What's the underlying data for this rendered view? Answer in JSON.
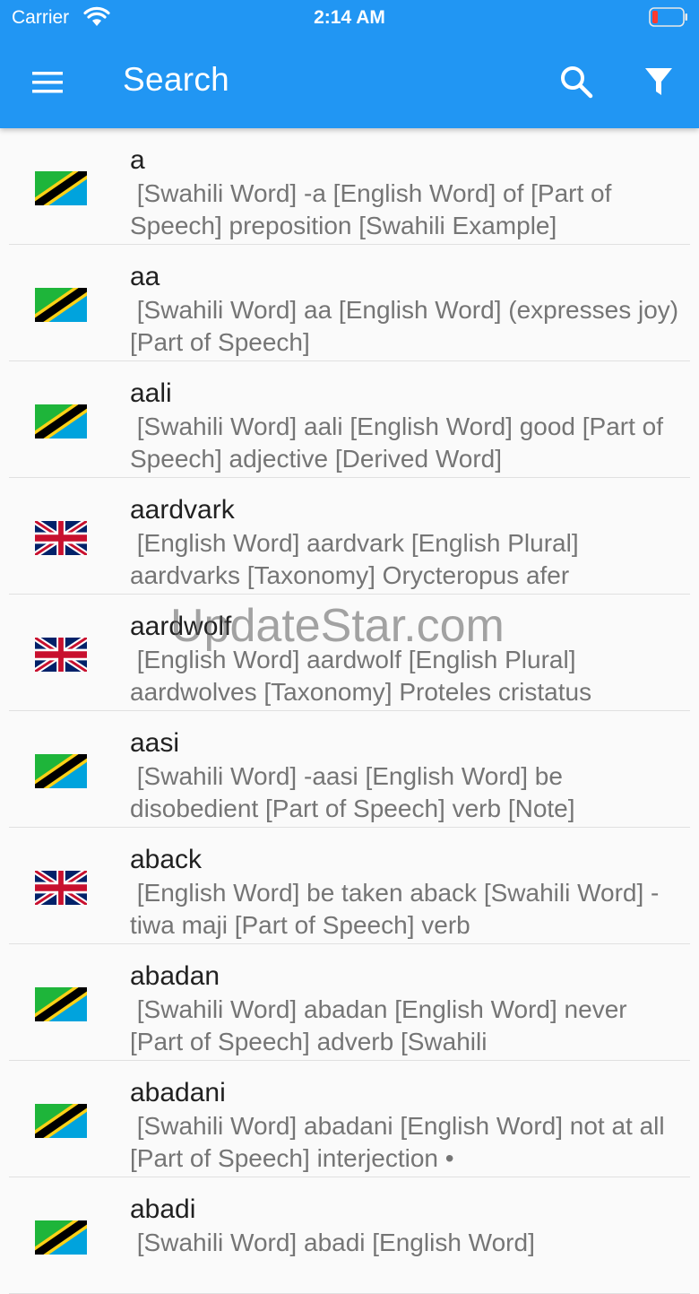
{
  "status_bar": {
    "carrier": "Carrier",
    "time": "2:14 AM"
  },
  "app_bar": {
    "title": "Search"
  },
  "watermark": "UpdateStar.com",
  "entries": [
    {
      "word": "a",
      "flag": "tz",
      "definition": " [Swahili Word] -a [English Word] of [Part of Speech] preposition [Swahili Example]"
    },
    {
      "word": "aa",
      "flag": "tz",
      "definition": " [Swahili Word] aa [English Word] (expresses joy) [Part of Speech]"
    },
    {
      "word": "aali",
      "flag": "tz",
      "definition": " [Swahili Word] aali [English Word] good [Part of Speech] adjective [Derived Word]"
    },
    {
      "word": "aardvark",
      "flag": "uk",
      "definition": " [English Word] aardvark [English Plural] aardvarks [Taxonomy] Orycteropus afer"
    },
    {
      "word": "aardwolf",
      "flag": "uk",
      "definition": " [English Word] aardwolf [English Plural] aardwolves [Taxonomy] Proteles cristatus"
    },
    {
      "word": "aasi",
      "flag": "tz",
      "definition": " [Swahili Word] -aasi [English Word] be disobedient [Part of Speech] verb [Note]"
    },
    {
      "word": "aback",
      "flag": "uk",
      "definition": " [English Word] be taken aback [Swahili Word] -tiwa maji [Part of Speech] verb"
    },
    {
      "word": "abadan",
      "flag": "tz",
      "definition": " [Swahili Word] abadan [English Word] never [Part of Speech] adverb [Swahili"
    },
    {
      "word": "abadani",
      "flag": "tz",
      "definition": " [Swahili Word] abadani [English Word] not at all [Part of Speech] interjection •"
    },
    {
      "word": "abadi",
      "flag": "tz",
      "definition": " [Swahili Word] abadi [English Word]"
    }
  ],
  "colors": {
    "app_bar": "#2196f3",
    "word": "#212121",
    "definition": "#757575"
  }
}
